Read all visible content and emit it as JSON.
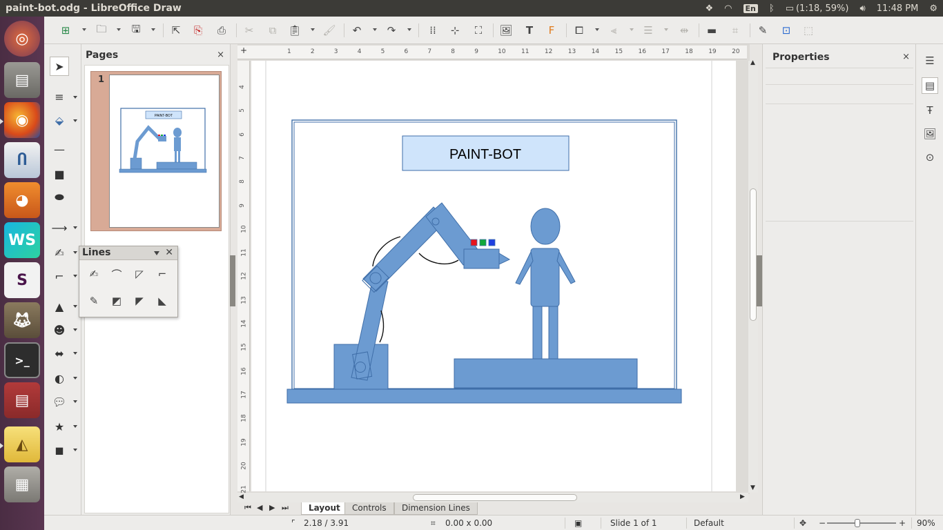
{
  "window": {
    "title": "paint-bot.odg - LibreOffice Draw"
  },
  "tray": {
    "lang": "En",
    "battery": "(1:18, 59%)",
    "clock": "11:48 PM"
  },
  "pages_pane": {
    "title": "Pages",
    "page_number": "1",
    "thumb_label": "PAINT-BOT"
  },
  "lines_toolbar": {
    "title": "Lines"
  },
  "drawing": {
    "title_box": "PAINT-BOT"
  },
  "ruler": {
    "h_ticks": [
      "1",
      "2",
      "3",
      "4",
      "5",
      "6",
      "7",
      "8",
      "9",
      "10",
      "11",
      "12",
      "13",
      "14",
      "15",
      "16",
      "17",
      "18",
      "19",
      "20"
    ],
    "v_ticks": [
      "4",
      "5",
      "6",
      "7",
      "8",
      "9",
      "10",
      "11",
      "12",
      "13",
      "14",
      "15",
      "16",
      "17",
      "18",
      "19",
      "20",
      "21"
    ]
  },
  "tabs": [
    {
      "label": "Layout"
    },
    {
      "label": "Controls"
    },
    {
      "label": "Dimension Lines"
    }
  ],
  "properties": {
    "title": "Properties"
  },
  "status": {
    "position": "2.18 / 3.91",
    "size": "0.00 x 0.00",
    "slide": "Slide 1 of 1",
    "master": "Default",
    "zoom": "90%",
    "zoom_minus": "−",
    "zoom_plus": "+"
  },
  "colors": {
    "shape_fill": "#6c9bd1",
    "shape_stroke": "#3f6ea8",
    "title_fill": "#cfe4fb",
    "paint_red": "#e8141c",
    "paint_green": "#12a83a",
    "paint_blue": "#1e3fe0"
  }
}
